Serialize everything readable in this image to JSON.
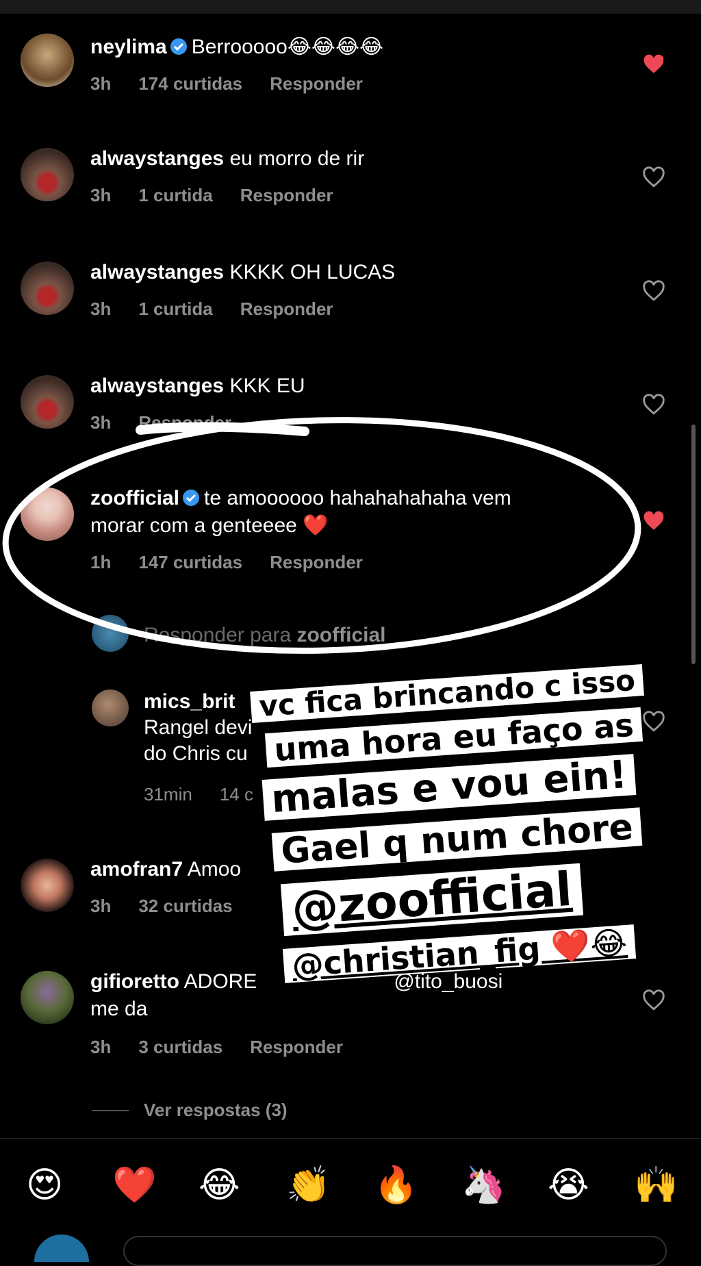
{
  "comments": [
    {
      "user": "neylima",
      "text": "Berrooooo😂😂😂😂",
      "time": "3h",
      "likes": "174 curtidas",
      "reply": "Responder",
      "liked": true
    },
    {
      "user": "alwaystanges",
      "text": "eu morro de rir",
      "time": "3h",
      "likes": "1 curtida",
      "reply": "Responder",
      "liked": false
    },
    {
      "user": "alwaystanges",
      "text": "KKKK OH LUCAS",
      "time": "3h",
      "likes": "1 curtida",
      "reply": "Responder",
      "liked": false
    },
    {
      "user": "alwaystanges",
      "text": "KKK EU",
      "time": "3h",
      "likes": "",
      "reply": "Responder",
      "liked": false
    },
    {
      "user": "zoofficial",
      "text1": "te amoooooo hahahahahaha vem",
      "text2": "morar com a genteeee ❤️",
      "time": "1h",
      "likes": "147 curtidas",
      "reply": "Responder",
      "liked": true
    }
  ],
  "reply_box": {
    "prefix": "Responder para ",
    "user": "zoofficial"
  },
  "nested_reply": {
    "user": "mics_brit",
    "line2": "Rangel devi",
    "line3": "do Chris cu",
    "time": "31min",
    "likes": "14 c"
  },
  "more_comments": [
    {
      "user": "amofran7",
      "text": "Amoo",
      "time": "3h",
      "likes": "32 curtidas"
    },
    {
      "user": "gifioretto",
      "text1": "ADORE",
      "text1b": "@tito_buosi",
      "text2": "me da",
      "time": "3h",
      "likes": "3 curtidas",
      "reply": "Responder"
    }
  ],
  "view_replies": "Ver respostas (3)",
  "emoji_bar": [
    "😍",
    "❤️",
    "😂",
    "👏",
    "🔥",
    "🦄",
    "😭",
    "🙌"
  ],
  "stickers": [
    "vc fica brincando c isso",
    "uma hora eu faço as",
    "malas e vou ein!",
    "Gael q num chore",
    "@zoofficial",
    "@christian_fig ❤️😂"
  ],
  "colors": {
    "like_red": "#ed4956",
    "verified_blue": "#3897f0",
    "meta_gray": "#8e8e8e"
  }
}
